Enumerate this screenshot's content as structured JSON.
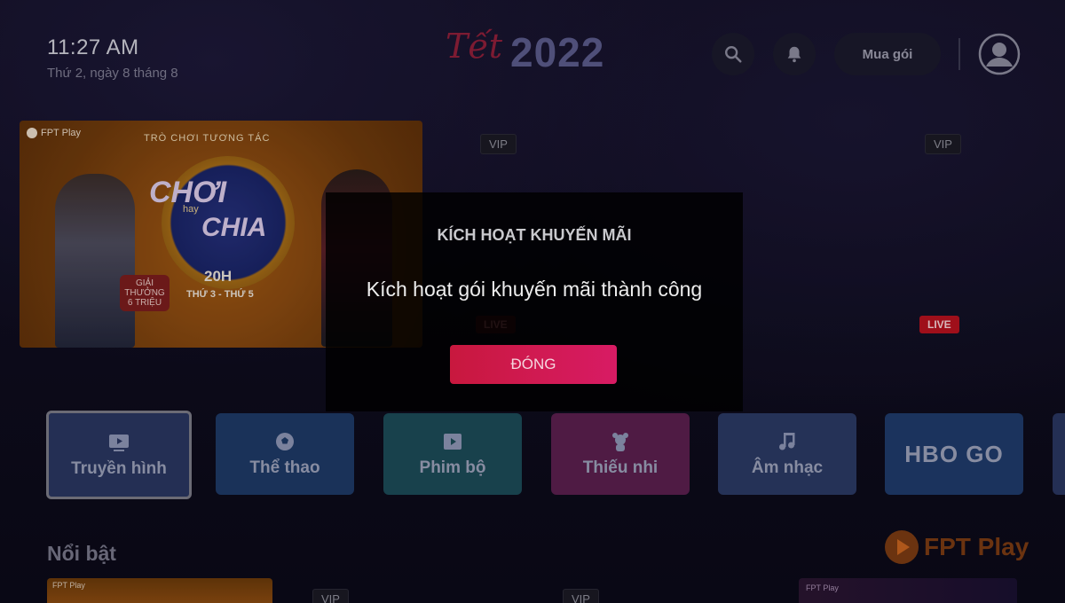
{
  "header": {
    "time": "11:27 AM",
    "date": "Thứ 2, ngày 8 tháng 8",
    "logo_script": "Tết",
    "logo_year": "2022",
    "buy_label": "Mua gói"
  },
  "banner": {
    "brand": "FPT Play",
    "tagline": "TRÒ CHƠI TƯƠNG TÁC",
    "title_line1": "CHƠI",
    "title_mid": "hay",
    "title_line2": "CHIA",
    "time": "20H",
    "schedule": "THỨ 3 - THỨ 5",
    "prize": "GIẢI THƯỞNG 6 TRIỆU"
  },
  "badges": {
    "vip": "VIP",
    "live": "LIVE"
  },
  "categories": [
    {
      "label": "Truyền hình"
    },
    {
      "label": "Thể thao"
    },
    {
      "label": "Phim bộ"
    },
    {
      "label": "Thiếu nhi"
    },
    {
      "label": "Âm nhạc"
    },
    {
      "label": "HBO GO"
    }
  ],
  "section": {
    "title": "Nổi bật",
    "brand": "FPT Play"
  },
  "thumbs": {
    "brand": "FPT Play"
  },
  "dialog": {
    "title": "KÍCH HOẠT KHUYẾN MÃI",
    "message": "Kích hoạt gói khuyến mãi thành công",
    "button": "ĐÓNG"
  },
  "colors": {
    "accent_start": "#c8183e",
    "accent_end": "#d81b64",
    "cat_truyenhinh": "#2a3660",
    "cat_thethao": "#1e3a66",
    "cat_phimbo": "#1c4a57",
    "cat_thieunhi": "#5a1f4e",
    "cat_amnhac": "#2b3a63",
    "cat_hbo": "#1f3b6a"
  }
}
